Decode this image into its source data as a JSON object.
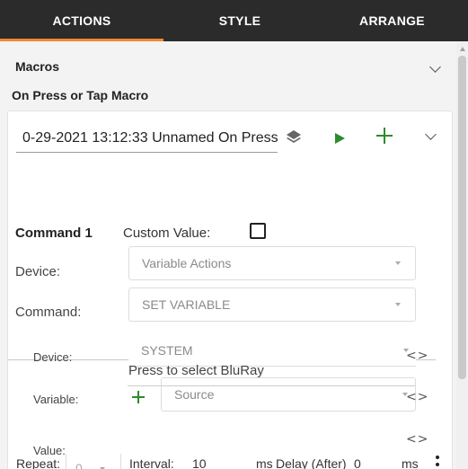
{
  "tabs": [
    {
      "label": "ACTIONS",
      "active": true
    },
    {
      "label": "STYLE",
      "active": false
    },
    {
      "label": "ARRANGE",
      "active": false
    }
  ],
  "macros": {
    "label": "Macros"
  },
  "macro_section": {
    "title": "On Press or Tap Macro"
  },
  "macro": {
    "name": "0-29-2021 13:12:33 Unnamed On Press"
  },
  "command": {
    "title": "Command 1",
    "custom_value_label": "Custom Value:",
    "custom_value_checked": false,
    "device_label": "Device:",
    "device_value": "Variable Actions",
    "command_label": "Command:",
    "command_value": "SET VARIABLE"
  },
  "params": {
    "device_label": "Device:",
    "device_value": "SYSTEM",
    "variable_label": "Variable:",
    "variable_value": "Source",
    "value_label": "Value:",
    "value_value": "Press to select BluRay"
  },
  "timing": {
    "repeat_label": "Repeat:",
    "repeat_value": "0",
    "interval_label": "Interval:",
    "interval_value": "10",
    "interval_unit": "ms",
    "delay_label": "Delay (After)",
    "delay_value": "0",
    "delay_unit": "ms"
  },
  "icons": {
    "code": "<>"
  },
  "colors": {
    "tab_bar": "#2b2b2b",
    "tab_active_underline": "#f08a2c",
    "accent_green": "#2e8b2e"
  }
}
